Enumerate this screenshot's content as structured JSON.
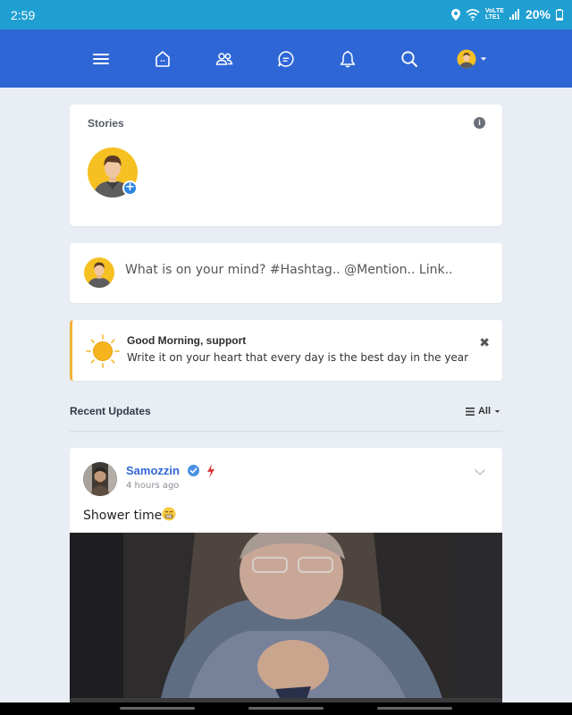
{
  "status_bar": {
    "time": "2:59",
    "network_top": "VoLTE",
    "network_bottom": "LTE1",
    "battery": "20%"
  },
  "nav": {
    "items": [
      {
        "name": "menu-icon"
      },
      {
        "name": "home-icon"
      },
      {
        "name": "friends-icon"
      },
      {
        "name": "messages-icon"
      },
      {
        "name": "notifications-icon"
      },
      {
        "name": "search-icon"
      },
      {
        "name": "profile-menu"
      }
    ],
    "brand_color": "#2f66d6"
  },
  "stories": {
    "title": "Stories",
    "info_glyph": "i",
    "add_glyph": "+"
  },
  "composer": {
    "placeholder": "What is on your mind? #Hashtag.. @Mention.. Link.."
  },
  "greeting": {
    "heading": "Good Morning, support",
    "body": "Write it on your heart that every day is the best day in the year",
    "close_glyph": "✖"
  },
  "feed": {
    "section_title": "Recent Updates",
    "filter_label": "All"
  },
  "post": {
    "author": "Samozzin",
    "time": "4 hours ago",
    "text": "Shower time"
  }
}
